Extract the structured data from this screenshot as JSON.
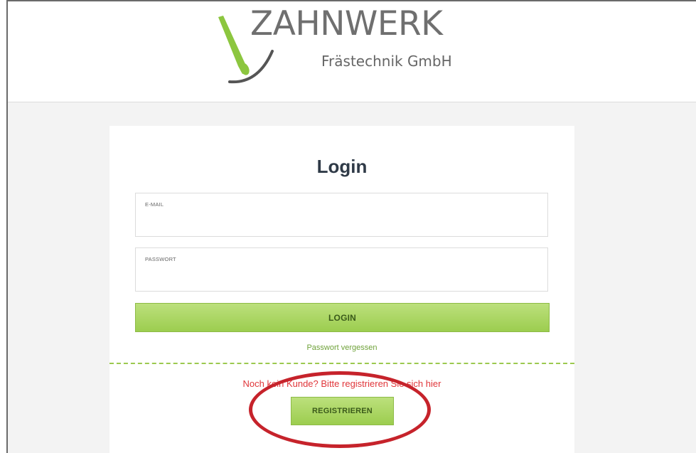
{
  "brand": {
    "name": "ZAHNWERK",
    "tagline": "Frästechnik GmbH",
    "colors": {
      "green": "#8cc63f",
      "dark": "#555555"
    }
  },
  "login": {
    "title": "Login",
    "email_label": "E-MAIL",
    "email_value": "",
    "password_label": "PASSWORT",
    "password_value": "",
    "submit_label": "LOGIN",
    "forgot_link": "Passwort vergessen"
  },
  "register": {
    "hint": "Noch kein Kunde? Bitte registrieren Sie sich hier",
    "button_label": "REGISTRIEREN"
  },
  "annotation": {
    "shape": "ellipse",
    "color": "#c6232b"
  }
}
